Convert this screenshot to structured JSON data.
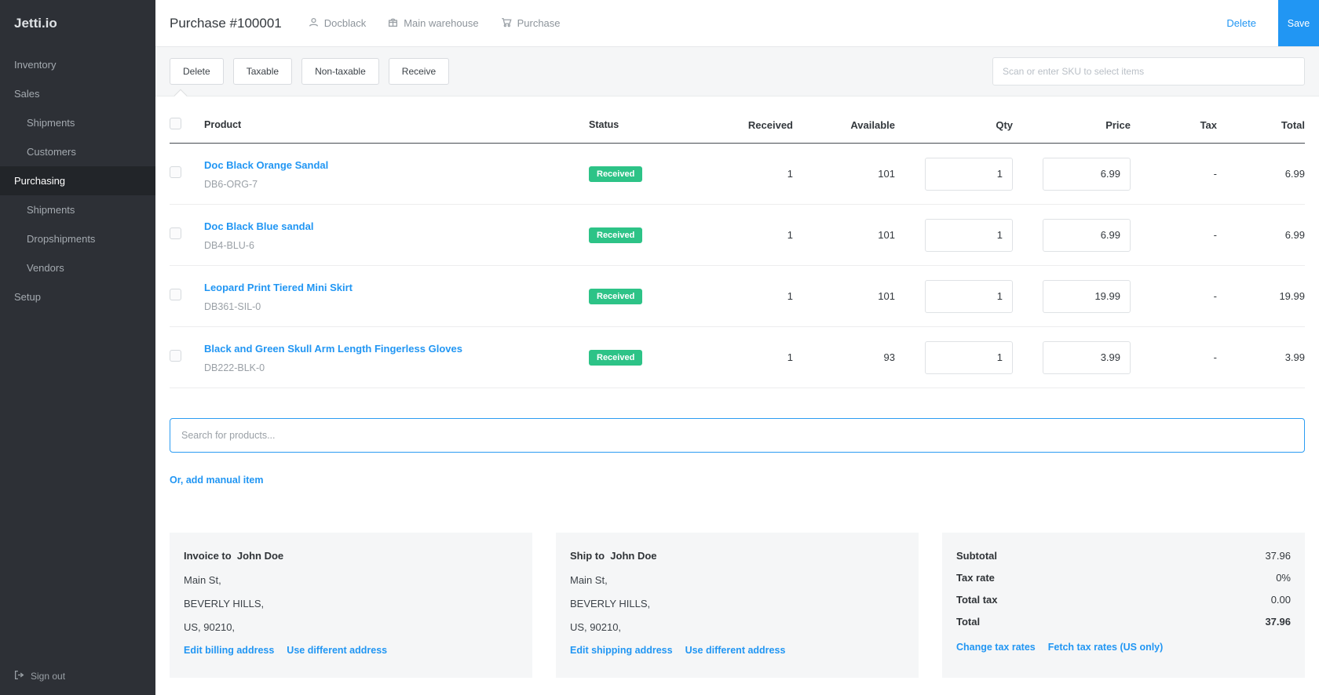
{
  "colors": {
    "accent": "#2196f3",
    "badge_green": "#2dc387",
    "sidebar_bg": "#2d3036"
  },
  "app": {
    "brand": "Jetti.io"
  },
  "sidebar": {
    "items": [
      {
        "label": "Inventory"
      },
      {
        "label": "Sales"
      },
      {
        "label": "Shipments"
      },
      {
        "label": "Customers"
      },
      {
        "label": "Purchasing"
      },
      {
        "label": "Shipments"
      },
      {
        "label": "Dropshipments"
      },
      {
        "label": "Vendors"
      },
      {
        "label": "Setup"
      }
    ],
    "sign_out": "Sign out"
  },
  "header": {
    "title": "Purchase #100001",
    "meta": [
      {
        "icon": "user-icon",
        "label": "Docblack"
      },
      {
        "icon": "warehouse-icon",
        "label": "Main warehouse"
      },
      {
        "icon": "cart-icon",
        "label": "Purchase"
      }
    ],
    "delete_label": "Delete",
    "save_label": "Save"
  },
  "toolbar": {
    "buttons": [
      "Delete",
      "Taxable",
      "Non-taxable",
      "Receive"
    ],
    "sku_placeholder": "Scan or enter SKU to select items"
  },
  "table": {
    "columns": [
      "Product",
      "Status",
      "Received",
      "Available",
      "Qty",
      "Price",
      "Tax",
      "Total"
    ],
    "rows": [
      {
        "name": "Doc Black Orange Sandal",
        "sku": "DB6-ORG-7",
        "status": "Received",
        "received": "1",
        "available": "101",
        "qty": "1",
        "price": "6.99",
        "tax": "-",
        "total": "6.99"
      },
      {
        "name": "Doc Black Blue sandal",
        "sku": "DB4-BLU-6",
        "status": "Received",
        "received": "1",
        "available": "101",
        "qty": "1",
        "price": "6.99",
        "tax": "-",
        "total": "6.99"
      },
      {
        "name": "Leopard Print Tiered Mini Skirt",
        "sku": "DB361-SIL-0",
        "status": "Received",
        "received": "1",
        "available": "101",
        "qty": "1",
        "price": "19.99",
        "tax": "-",
        "total": "19.99"
      },
      {
        "name": "Black and Green Skull Arm Length Fingerless Gloves",
        "sku": "DB222-BLK-0",
        "status": "Received",
        "received": "1",
        "available": "93",
        "qty": "1",
        "price": "3.99",
        "tax": "-",
        "total": "3.99"
      }
    ]
  },
  "product_search": {
    "placeholder": "Search for products..."
  },
  "add_manual_item": "Or, add manual item",
  "billing": {
    "heading": "Invoice to",
    "name": "John Doe",
    "lines": [
      "Main St,",
      "BEVERLY HILLS,",
      "US, 90210,"
    ],
    "links": [
      "Edit billing address",
      "Use different address"
    ]
  },
  "shipping": {
    "heading": "Ship to",
    "name": "John Doe",
    "lines": [
      "Main St,",
      "BEVERLY HILLS,",
      "US, 90210,"
    ],
    "links": [
      "Edit shipping address",
      "Use different address"
    ]
  },
  "totals": {
    "rows": [
      {
        "label": "Subtotal",
        "value": "37.96"
      },
      {
        "label": "Tax rate",
        "value": "0%"
      },
      {
        "label": "Total tax",
        "value": "0.00"
      },
      {
        "label": "Total",
        "value": "37.96"
      }
    ],
    "links": [
      "Change tax rates",
      "Fetch tax rates (US only)"
    ]
  }
}
